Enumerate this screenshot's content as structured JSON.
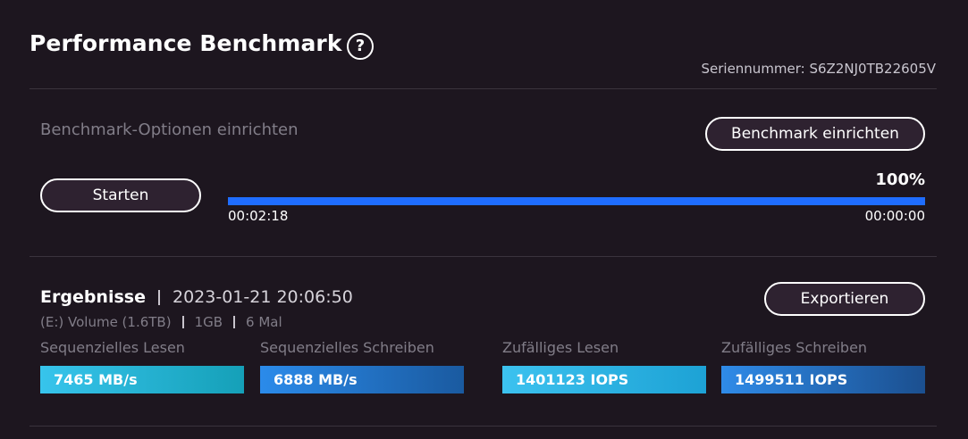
{
  "header": {
    "title": "Performance Benchmark",
    "help_icon": "?",
    "serial_label": "Seriennummer: S6Z2NJ0TB22605V"
  },
  "options": {
    "label": "Benchmark-Optionen einrichten",
    "setup_button": "Benchmark einrichten"
  },
  "run": {
    "start_button": "Starten",
    "progress_percent": 100,
    "progress_label": "100%",
    "elapsed": "00:02:18",
    "remaining": "00:00:00"
  },
  "results": {
    "title": "Ergebnisse",
    "timestamp": "2023-01-21 20:06:50",
    "volume": "(E:) Volume (1.6TB)",
    "size": "1GB",
    "runs": "6 Mal",
    "export_button": "Exportieren",
    "metrics": [
      {
        "label": "Sequenzielles Lesen",
        "value": "7465 MB/s"
      },
      {
        "label": "Sequenzielles Schreiben",
        "value": "6888 MB/s"
      },
      {
        "label": "Zufälliges Lesen",
        "value": "1401123 IOPS"
      },
      {
        "label": "Zufälliges Schreiben",
        "value": "1499511 IOPS"
      }
    ]
  },
  "colors": {
    "background": "#1d161f",
    "progress": "#1f6dff",
    "muted_text": "#817d88"
  }
}
